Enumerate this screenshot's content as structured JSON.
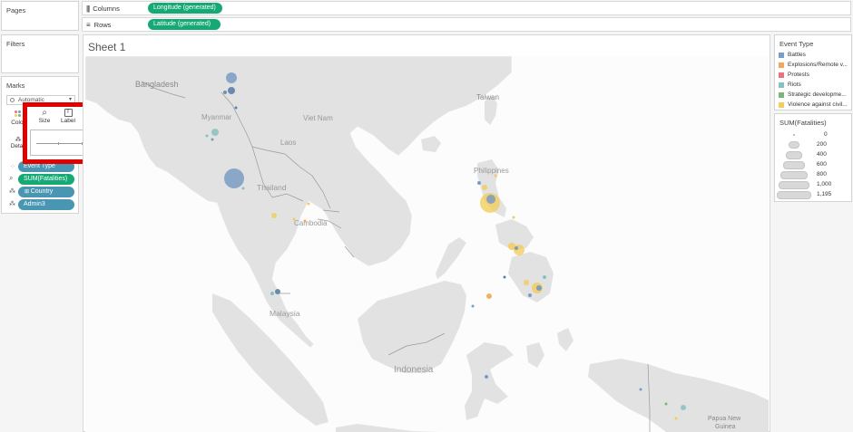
{
  "pages_panel": {
    "title": "Pages"
  },
  "columns_shelf": {
    "label": "Columns",
    "pill": "Longitude (generated)"
  },
  "rows_shelf": {
    "label": "Rows",
    "pill": "Latitude (generated)"
  },
  "filters_panel": {
    "title": "Filters"
  },
  "marks_panel": {
    "title": "Marks",
    "mark_type": "Automatic",
    "buttons": [
      {
        "label": "Color",
        "icon": "color-dots-icon"
      },
      {
        "label": "Size",
        "icon": "size-icon"
      },
      {
        "label": "Label",
        "icon": "label-icon"
      },
      {
        "label": "Detail",
        "icon": "detail-icon"
      }
    ],
    "pills": [
      {
        "label": "Event Type",
        "icon": "color-dots-icon",
        "color": "#4996b2"
      },
      {
        "label": "SUM(Fatalities)",
        "icon": "size-icon",
        "color": "#14a975"
      },
      {
        "label": "Country",
        "icon": "detail-icon",
        "color": "#4996b2"
      },
      {
        "label": "Admin3",
        "icon": "detail-icon",
        "color": "#4996b2"
      }
    ],
    "size_slider": {
      "value": 0.7
    }
  },
  "sheet": {
    "title": "Sheet 1"
  },
  "map": {
    "labels": {
      "bangladesh": "Bangladesh",
      "taiwan": "Taiwan",
      "myanmar": "Myanmar",
      "vietnam": "Viet Nam",
      "laos": "Laos",
      "philippines": "Philippines",
      "thailand": "Thailand",
      "cambodia": "Cambodia",
      "malaysia": "Malaysia",
      "indonesia": "Indonesia",
      "png": "Papua New Guinea"
    }
  },
  "event_legend": {
    "title": "Event Type",
    "items": [
      {
        "label": "Battles",
        "color": "#7b9cc3"
      },
      {
        "label": "Explosions/Remote v...",
        "color": "#f1a85a"
      },
      {
        "label": "Protests",
        "color": "#e8737a"
      },
      {
        "label": "Riots",
        "color": "#86c2bd"
      },
      {
        "label": "Strategic developme...",
        "color": "#7db479"
      },
      {
        "label": "Violence against civil...",
        "color": "#f2cd5d"
      }
    ]
  },
  "size_legend": {
    "title": "SUM(Fatalities)",
    "items": [
      "0",
      "200",
      "400",
      "600",
      "800",
      "1,000",
      "1,195"
    ]
  },
  "highlight": {
    "color": "#e00000"
  }
}
